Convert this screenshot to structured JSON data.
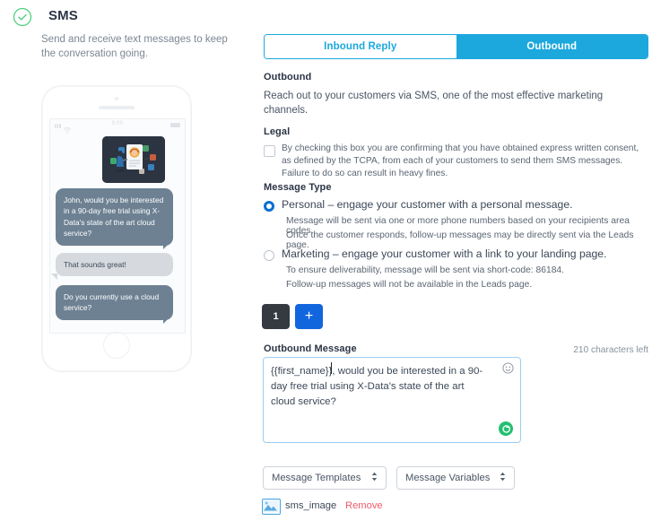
{
  "header": {
    "status_icon": "check-circle-icon",
    "status_color": "#4fd07f",
    "title": "SMS",
    "description": "Send and receive text messages to keep the conversation going."
  },
  "phone_preview": {
    "status_bar": {
      "signal_icon": "signal-bars-icon",
      "wifi_icon": "wifi-icon",
      "time": "9:00",
      "battery_icon": "battery-icon"
    },
    "attachment_image": "sms-preview-illustration",
    "messages": [
      {
        "direction": "outgoing",
        "text": "John, would you be interested in a 90-day free trial using X-Data's state of the art cloud service?"
      },
      {
        "direction": "incoming",
        "text": "That sounds great!"
      },
      {
        "direction": "outgoing",
        "text": "Do you currently use a cloud service?"
      }
    ],
    "home_button": "home-button"
  },
  "tabs": [
    {
      "label": "Inbound Reply",
      "active": false
    },
    {
      "label": "Outbound",
      "active": true
    }
  ],
  "outbound": {
    "section_title": "Outbound",
    "description": "Reach out to your customers via SMS, one of the most effective marketing channels."
  },
  "legal": {
    "label": "Legal",
    "checkbox_checked": false,
    "text": "By checking this box you are confirming that you have obtained express written consent, as defined by the TCPA, from each of your customers to send them SMS messages. Failure to do so can result in heavy fines."
  },
  "message_type": {
    "label": "Message Type",
    "options": [
      {
        "selected": true,
        "label": "Personal – engage your customer with a personal message.",
        "help": [
          "Message will be sent via one or more phone numbers based on your recipients area codes.",
          "Once the customer responds, follow-up messages may be directly sent via the Leads page."
        ]
      },
      {
        "selected": false,
        "label": "Marketing – engage your customer with a link to your landing page.",
        "help": [
          "To ensure deliverability, message will be sent via short-code: 86184.",
          "Follow-up messages will not be available in the Leads page."
        ]
      }
    ]
  },
  "stepper": {
    "count_label": "1",
    "add_label": "+"
  },
  "message_editor": {
    "label": "Outbound Message",
    "characters_left": "210 characters left",
    "value": "{{first_name}}, would you be interested in a 90-day free trial using X-Data's state of the art cloud service?",
    "emoji_icon": "smiley-icon",
    "refresh_icon": "refresh-icon"
  },
  "selectors": [
    {
      "label": "Message Templates"
    },
    {
      "label": "Message Variables"
    }
  ],
  "attachment": {
    "icon": "image-icon",
    "name": "sms_image",
    "remove_label": "Remove"
  },
  "colors": {
    "tab_accent": "#1ca8dd",
    "radio_selected": "#0a6ed1",
    "add_button": "#1266dd",
    "count_button": "#343a40",
    "remove_link": "#f05b6b",
    "badge_green": "#22c070",
    "bubble_outgoing": "#6d8193",
    "bubble_incoming": "#d6dade"
  }
}
